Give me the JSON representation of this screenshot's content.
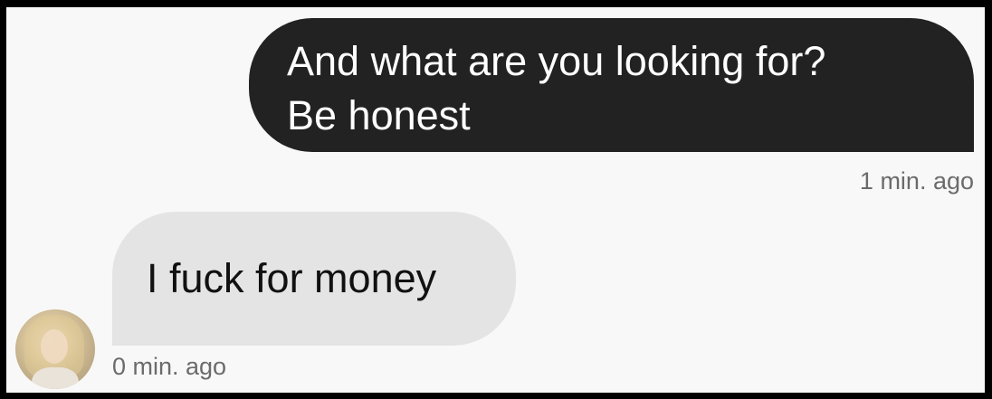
{
  "conversation": {
    "outgoing": {
      "line1": "And what are you looking for?",
      "line2": "Be honest",
      "timestamp": "1 min. ago"
    },
    "incoming": {
      "text": "I fuck for money",
      "timestamp": "0 min. ago"
    }
  },
  "colors": {
    "background": "#f8f8f8",
    "outgoing_bubble": "#222222",
    "incoming_bubble": "#e4e4e4",
    "timestamp": "#6b6b6b"
  }
}
